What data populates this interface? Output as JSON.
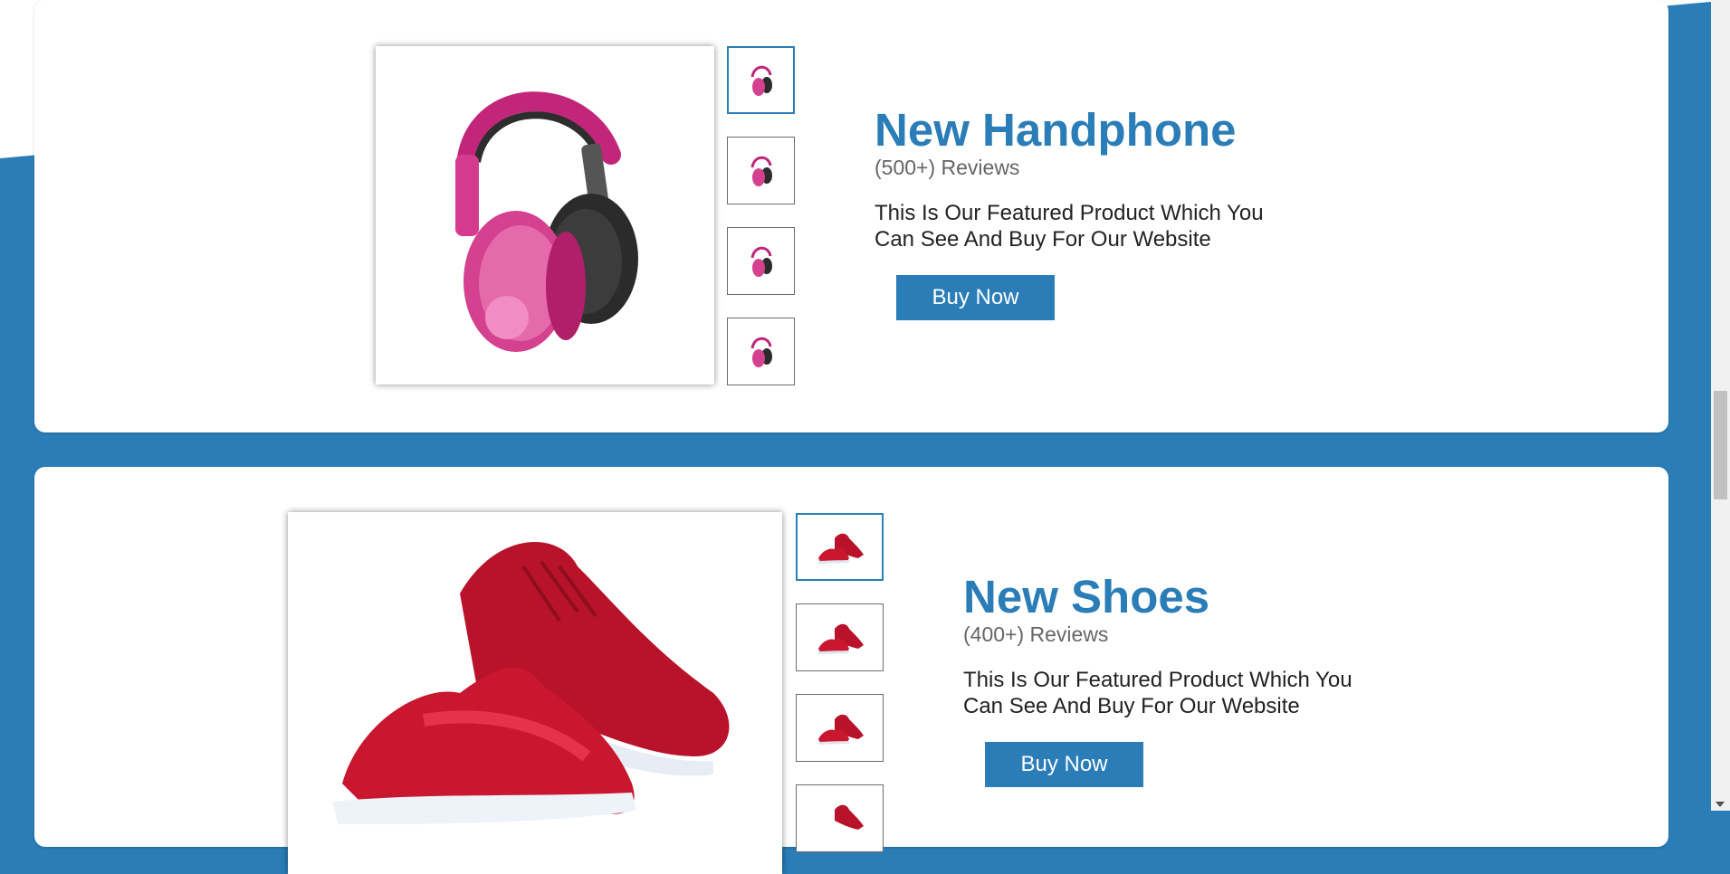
{
  "products": [
    {
      "title": "New Handphone",
      "reviews": "(500+) Reviews",
      "description": "This Is Our Featured Product Which You Can See And Buy For Our Website",
      "buy_label": "Buy Now",
      "image": "pink-headphones-image",
      "thumbnail_count": 4,
      "active_thumbnail": 1
    },
    {
      "title": "New Shoes",
      "reviews": "(400+) Reviews",
      "description": "This Is Our Featured Product Which You Can See And Buy For Our Website",
      "buy_label": "Buy Now",
      "image": "red-sneakers-image",
      "thumbnail_count": 4,
      "active_thumbnail": 1
    }
  ],
  "colors": {
    "accent": "#2a7db7",
    "review_text": "#666666",
    "body_text": "#222222"
  }
}
